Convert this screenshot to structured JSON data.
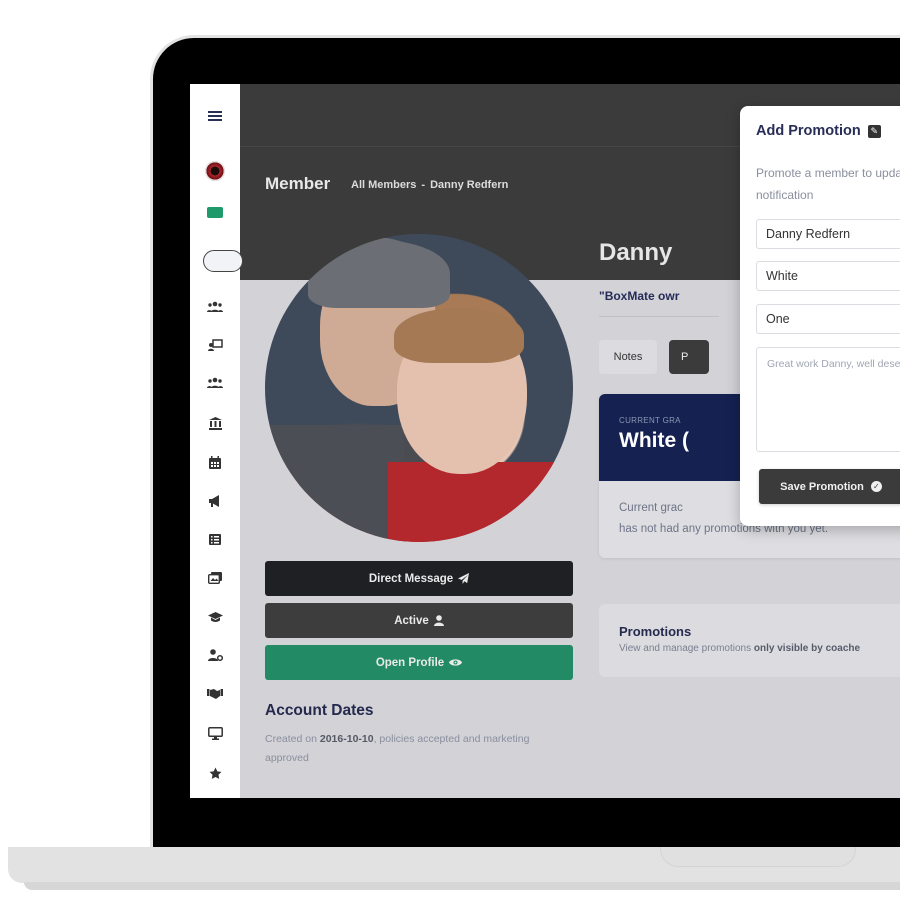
{
  "sidebar": {
    "items": [
      {
        "name": "menu",
        "icon": "hamburger-menu-icon"
      },
      {
        "name": "gym-logo",
        "icon": "club-logo-icon"
      },
      {
        "name": "box",
        "icon": "green-box-icon"
      },
      {
        "name": "search",
        "icon": "search-pill"
      },
      {
        "name": "members",
        "icon": "users-icon",
        "glyph": "👥"
      },
      {
        "name": "classes",
        "icon": "chalkboard-teacher-icon",
        "glyph": "🖵"
      },
      {
        "name": "groups",
        "icon": "users-group-icon",
        "glyph": "👥"
      },
      {
        "name": "bank",
        "icon": "university-icon",
        "glyph": "🏛"
      },
      {
        "name": "calendar",
        "icon": "calendar-icon",
        "glyph": "▦"
      },
      {
        "name": "announcements",
        "icon": "bullhorn-icon",
        "glyph": "📢"
      },
      {
        "name": "list",
        "icon": "list-alt-icon",
        "glyph": "☰"
      },
      {
        "name": "media",
        "icon": "images-icon",
        "glyph": "🖼"
      },
      {
        "name": "grading",
        "icon": "graduation-cap-icon",
        "glyph": "🎓"
      },
      {
        "name": "staff",
        "icon": "user-cog-icon",
        "glyph": "⚙"
      },
      {
        "name": "partners",
        "icon": "handshake-icon",
        "glyph": "🤝"
      },
      {
        "name": "display",
        "icon": "desktop-icon",
        "glyph": "🖥"
      },
      {
        "name": "favourites",
        "icon": "star-icon",
        "glyph": "★"
      }
    ]
  },
  "header": {
    "title": "Member",
    "breadcrumbs": [
      "All Members",
      "Danny Redfern"
    ],
    "separator": "-"
  },
  "member": {
    "name_visible": "Danny",
    "quote_visible": "\"BoxMate owr",
    "tabs": [
      {
        "label": "Notes",
        "active": false
      },
      {
        "label": "P",
        "active": true
      }
    ],
    "grade_card": {
      "label": "CURRENT GRA",
      "value": "White (",
      "description_line1": "Current grac",
      "description_line2": "has not had any promotions with you yet."
    },
    "promotions_card": {
      "title": "Promotions",
      "subtitle_normal": "View and manage promotions ",
      "subtitle_bold": "only visible by coache"
    }
  },
  "actions": {
    "direct_message": {
      "label": "Direct Message",
      "icon": "paper-plane-icon",
      "glyph": "➤"
    },
    "active": {
      "label": "Active",
      "icon": "user-icon",
      "glyph": "👤"
    },
    "open_profile": {
      "label": "Open Profile",
      "icon": "eye-icon",
      "glyph": "👁"
    }
  },
  "account_dates": {
    "title": "Account Dates",
    "text_prefix": "Created on ",
    "created_date": "2016-10-10",
    "text_suffix": ", policies accepted and marketing approved"
  },
  "modal": {
    "title": "Add Promotion",
    "title_icon": "edit-icon",
    "description_line1": "Promote a member to update the",
    "description_line2": "notification",
    "member_field": "Danny Redfern",
    "grade_field": "White",
    "stripe_field": "One",
    "message_placeholder": "Great work Danny, well deserved k",
    "save_label": "Save Promotion",
    "save_icon": "check-circle-icon"
  },
  "colors": {
    "accent_navy": "#142151",
    "success_green": "#228a65",
    "header_dark": "#3b3b3b",
    "sidebar_green": "#1f9a6b"
  }
}
